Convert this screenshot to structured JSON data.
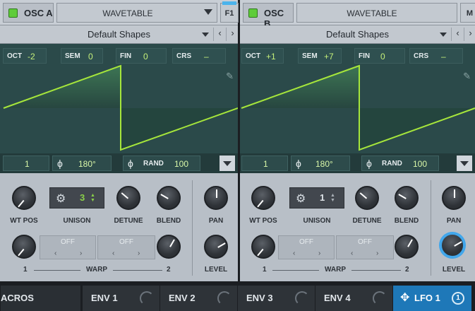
{
  "osc_a": {
    "name": "OSC A",
    "enabled": true,
    "wavetable": "WAVETABLE",
    "filter_button": "F1",
    "shape": "Default Shapes",
    "params": {
      "oct_k": "OCT",
      "oct_v": "-2",
      "sem_k": "SEM",
      "sem_v": "0",
      "fin_k": "FIN",
      "fin_v": "0",
      "crs_k": "CRS",
      "crs_v": "–"
    },
    "frame": "1",
    "phase": "180°",
    "rand_k": "RAND",
    "rand_v": "100",
    "wt_pos": "WT POS",
    "unison_label": "UNISON",
    "unison_value": "3",
    "detune": "DETUNE",
    "blend": "BLEND",
    "pan": "PAN",
    "level": "LEVEL",
    "warp_label": "WARP",
    "warp1_value": "OFF",
    "warp2_value": "OFF",
    "warp_num1": "1",
    "warp_num2": "2"
  },
  "osc_b": {
    "name": "OSC B",
    "enabled": true,
    "wavetable": "WAVETABLE",
    "filter_button": "M",
    "shape": "Default Shapes",
    "params": {
      "oct_k": "OCT",
      "oct_v": "+1",
      "sem_k": "SEM",
      "sem_v": "+7",
      "fin_k": "FIN",
      "fin_v": "0",
      "crs_k": "CRS",
      "crs_v": "–"
    },
    "frame": "1",
    "phase": "180°",
    "rand_k": "RAND",
    "rand_v": "100",
    "wt_pos": "WT POS",
    "unison_label": "UNISON",
    "unison_value": "1",
    "detune": "DETUNE",
    "blend": "BLEND",
    "pan": "PAN",
    "level": "LEVEL",
    "warp_label": "WARP",
    "warp1_value": "OFF",
    "warp2_value": "OFF",
    "warp_num1": "1",
    "warp_num2": "2"
  },
  "tabs": [
    {
      "label": "ACROS"
    },
    {
      "label": "ENV 1"
    },
    {
      "label": "ENV 2"
    },
    {
      "label": "ENV 3"
    },
    {
      "label": "ENV 4"
    },
    {
      "label": "LFO 1",
      "count": "1"
    }
  ],
  "colors": {
    "led": "#5fcc3a",
    "wave": "#a6e63b",
    "accent": "#4bb3ec",
    "active_tab": "#1e78b8"
  },
  "icons": {
    "phase": "phase-icon",
    "pencil": "pencil-icon",
    "gear": "gear-icon",
    "move": "move-icon"
  }
}
